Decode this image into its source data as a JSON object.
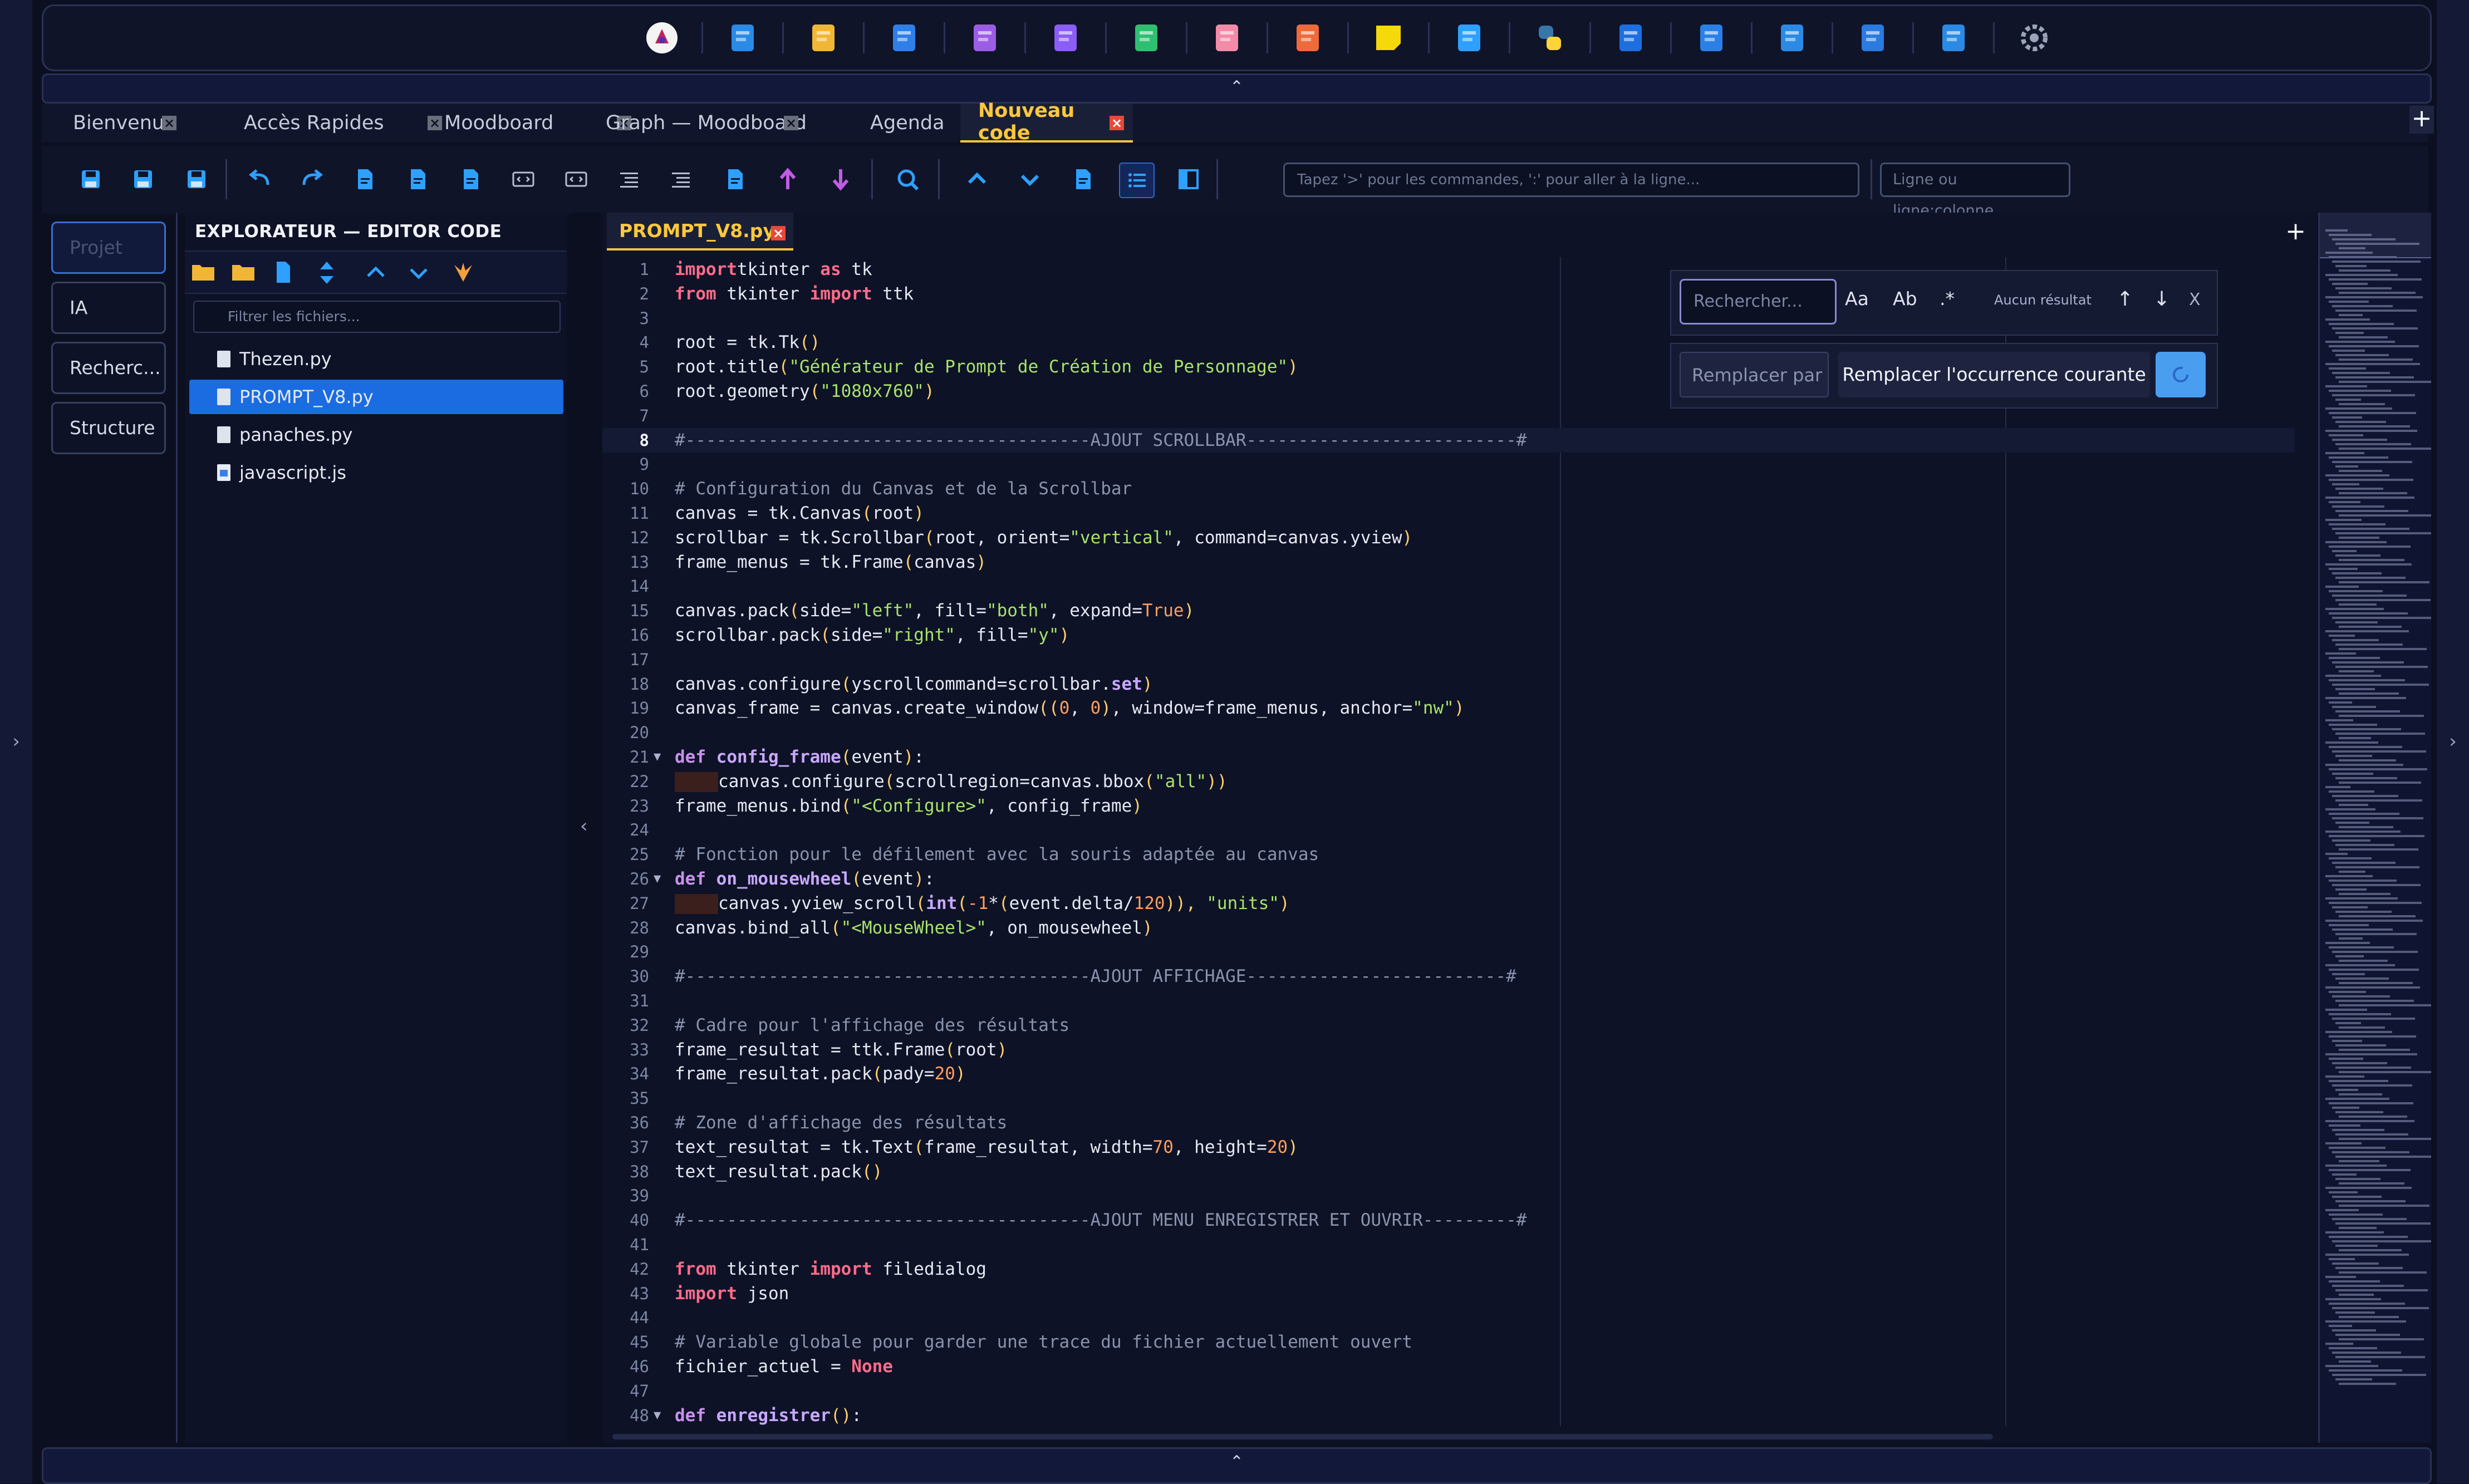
{
  "dock": {
    "items": [
      "app-logo-icon",
      "window-icon",
      "gallery-icon",
      "calendar-icon",
      "purple-app-icon",
      "doc-icon",
      "xls-icon",
      "pdf-icon",
      "epub-icon",
      "sticky-note-icon",
      "code-file-icon",
      "python-icon",
      "waveform-icon",
      "image-icon",
      "music-icon",
      "video-icon",
      "browser-icon",
      "settings-icon"
    ]
  },
  "tabs": [
    {
      "label": "Bienvenue",
      "active": false
    },
    {
      "label": "Accès Rapides",
      "active": false
    },
    {
      "label": "Moodboard",
      "active": false
    },
    {
      "label": "Graph — Moodboard",
      "active": false
    },
    {
      "label": "Agenda",
      "active": false
    },
    {
      "label": "Nouveau code",
      "active": true
    }
  ],
  "toolbar": {
    "command_placeholder": "Tapez '>' pour les commandes, ':' pour aller à la ligne...",
    "line_placeholder": "Ligne ou ligne:colonne"
  },
  "left_nav": {
    "items": [
      {
        "label": "Projet",
        "active": true
      },
      {
        "label": "IA",
        "active": false
      },
      {
        "label": "Recherc...",
        "active": false
      },
      {
        "label": "Structure",
        "active": false
      }
    ]
  },
  "explorer": {
    "title": "EXPLORATEUR — EDITOR CODE",
    "filter_placeholder": "Filtrer les fichiers...",
    "files": [
      {
        "name": "Thezen.py",
        "selected": false,
        "type": "py"
      },
      {
        "name": "PROMPT_V8.py",
        "selected": true,
        "type": "py"
      },
      {
        "name": "panaches.py",
        "selected": false,
        "type": "py"
      },
      {
        "name": "javascript.js",
        "selected": false,
        "type": "js"
      }
    ]
  },
  "editor": {
    "tab": "PROMPT_V8.py",
    "current_line": 8
  },
  "find": {
    "placeholder": "Rechercher...",
    "opt_case": "Aa",
    "opt_word": "Ab",
    "opt_regex": ".*",
    "status": "Aucun résultat",
    "close": "X",
    "replace_placeholder": "Remplacer par",
    "replace_button": "Remplacer l'occurrence courante"
  },
  "code": [
    {
      "n": "1",
      "t": [
        [
          "kw",
          "import"
        ],
        [
          "",
          "tkinter "
        ],
        [
          "kw",
          "as"
        ],
        [
          "",
          " tk"
        ]
      ]
    },
    {
      "n": "2",
      "t": [
        [
          "kw",
          "from"
        ],
        [
          "",
          "",
          " tkinter "
        ],
        [
          "kw",
          "import"
        ],
        [
          "",
          " ttk"
        ]
      ]
    },
    {
      "n": "3",
      "t": []
    },
    {
      "n": "4",
      "t": [
        [
          "",
          "root = tk.Tk"
        ],
        [
          "bi",
          "()"
        ]
      ]
    },
    {
      "n": "5",
      "t": [
        [
          "",
          "root.title"
        ],
        [
          "bi",
          "("
        ],
        [
          "st",
          "\"Générateur de Prompt de Création de Personnage\""
        ],
        [
          "bi",
          ")"
        ]
      ]
    },
    {
      "n": "6",
      "t": [
        [
          "",
          "root.geometry"
        ],
        [
          "bi",
          "("
        ],
        [
          "st",
          "\"1080x760\""
        ],
        [
          "bi",
          ")"
        ]
      ]
    },
    {
      "n": "7",
      "t": []
    },
    {
      "n": "8",
      "t": [
        [
          "cm",
          "#---------------------------------------AJOUT SCROLLBAR--------------------------#"
        ]
      ]
    },
    {
      "n": "9",
      "t": []
    },
    {
      "n": "10",
      "t": [
        [
          "cm",
          "# Configuration du Canvas et de la Scrollbar"
        ]
      ]
    },
    {
      "n": "11",
      "t": [
        [
          "",
          "canvas = tk.Canvas"
        ],
        [
          "bi",
          "("
        ],
        [
          "",
          "root"
        ],
        [
          "bi",
          ")"
        ]
      ]
    },
    {
      "n": "12",
      "t": [
        [
          "",
          "scrollbar = tk.Scrollbar"
        ],
        [
          "bi",
          "("
        ],
        [
          "",
          "root, orient="
        ],
        [
          "st",
          "\"vertical\""
        ],
        [
          "",
          ", command=canvas.yview"
        ],
        [
          "bi",
          ")"
        ]
      ]
    },
    {
      "n": "13",
      "t": [
        [
          "",
          "frame_menus = tk.Frame"
        ],
        [
          "bi",
          "("
        ],
        [
          "",
          "canvas"
        ],
        [
          "bi",
          ")"
        ]
      ]
    },
    {
      "n": "14",
      "t": []
    },
    {
      "n": "15",
      "t": [
        [
          "",
          "canvas.pack"
        ],
        [
          "bi",
          "("
        ],
        [
          "",
          "side="
        ],
        [
          "st",
          "\"left\""
        ],
        [
          "",
          ", fill="
        ],
        [
          "st",
          "\"both\""
        ],
        [
          "",
          ", expand="
        ],
        [
          "nm",
          "True"
        ],
        [
          "bi",
          ")"
        ]
      ]
    },
    {
      "n": "16",
      "t": [
        [
          "",
          "scrollbar.pack"
        ],
        [
          "bi",
          "("
        ],
        [
          "",
          "side="
        ],
        [
          "st",
          "\"right\""
        ],
        [
          "",
          ", fill="
        ],
        [
          "st",
          "\"y\""
        ],
        [
          "bi",
          ")"
        ]
      ]
    },
    {
      "n": "17",
      "t": []
    },
    {
      "n": "18",
      "t": [
        [
          "",
          "canvas.configure"
        ],
        [
          "bi",
          "("
        ],
        [
          "",
          "yscrollcommand=scrollbar."
        ],
        [
          "fn",
          "set"
        ],
        [
          "bi",
          ")"
        ]
      ]
    },
    {
      "n": "19",
      "t": [
        [
          "",
          "canvas_frame = canvas.create_window"
        ],
        [
          "bi",
          "(("
        ],
        [
          "nm",
          "0"
        ],
        [
          "",
          ", "
        ],
        [
          "nm",
          "0"
        ],
        [
          "bi",
          ")"
        ],
        [
          "",
          ", window=frame_menus, anchor="
        ],
        [
          "st",
          "\"nw\""
        ],
        [
          "bi",
          ")"
        ]
      ]
    },
    {
      "n": "20",
      "t": []
    },
    {
      "n": "21",
      "fold": true,
      "t": [
        [
          "kw2",
          "def"
        ],
        [
          "",
          " "
        ],
        [
          "fn",
          "config_frame"
        ],
        [
          "bi",
          "("
        ],
        [
          "",
          "event"
        ],
        [
          "bi",
          ")"
        ],
        [
          "",
          ":"
        ]
      ]
    },
    {
      "n": "22",
      "indent": true,
      "t": [
        [
          "",
          "canvas.configure"
        ],
        [
          "bi",
          "("
        ],
        [
          "",
          "scrollregion=canvas.bbox"
        ],
        [
          "bi",
          "("
        ],
        [
          "st",
          "\"all\""
        ],
        [
          "bi",
          "))"
        ]
      ]
    },
    {
      "n": "23",
      "t": [
        [
          "",
          "frame_menus.bind"
        ],
        [
          "bi",
          "("
        ],
        [
          "st",
          "\"<Configure>\""
        ],
        [
          "",
          ", config_frame"
        ],
        [
          "bi",
          ")"
        ]
      ]
    },
    {
      "n": "24",
      "t": []
    },
    {
      "n": "25",
      "t": [
        [
          "cm",
          "# Fonction pour le défilement avec la souris adaptée au canvas"
        ]
      ]
    },
    {
      "n": "26",
      "fold": true,
      "t": [
        [
          "kw2",
          "def"
        ],
        [
          "",
          " "
        ],
        [
          "fn",
          "on_mousewheel"
        ],
        [
          "bi",
          "("
        ],
        [
          "",
          "event"
        ],
        [
          "bi",
          ")"
        ],
        [
          "",
          ":"
        ]
      ]
    },
    {
      "n": "27",
      "indent": true,
      "t": [
        [
          "",
          "canvas.yview_scroll"
        ],
        [
          "bi",
          "("
        ],
        [
          "fn",
          "int"
        ],
        [
          "bi",
          "("
        ],
        [
          "nm",
          "-1"
        ],
        [
          "",
          "*"
        ],
        [
          "bi",
          "("
        ],
        [
          "",
          "event.delta/"
        ],
        [
          "nm",
          "120"
        ],
        [
          "bi",
          ")),"
        ],
        [
          "",
          " "
        ],
        [
          "st",
          "\"units\""
        ],
        [
          "bi",
          ")"
        ]
      ]
    },
    {
      "n": "28",
      "t": [
        [
          "",
          "canvas.bind_all"
        ],
        [
          "bi",
          "("
        ],
        [
          "st",
          "\"<MouseWheel>\""
        ],
        [
          "",
          ", on_mousewheel"
        ],
        [
          "bi",
          ")"
        ]
      ]
    },
    {
      "n": "29",
      "t": []
    },
    {
      "n": "30",
      "t": [
        [
          "cm",
          "#---------------------------------------AJOUT AFFICHAGE-------------------------#"
        ]
      ]
    },
    {
      "n": "31",
      "t": []
    },
    {
      "n": "32",
      "t": [
        [
          "cm",
          "# Cadre pour l'affichage des résultats"
        ]
      ]
    },
    {
      "n": "33",
      "t": [
        [
          "",
          "frame_resultat = ttk.Frame"
        ],
        [
          "bi",
          "("
        ],
        [
          "",
          "root"
        ],
        [
          "bi",
          ")"
        ]
      ]
    },
    {
      "n": "34",
      "t": [
        [
          "",
          "frame_resultat.pack"
        ],
        [
          "bi",
          "("
        ],
        [
          "",
          "pady="
        ],
        [
          "nm",
          "20"
        ],
        [
          "bi",
          ")"
        ]
      ]
    },
    {
      "n": "35",
      "t": []
    },
    {
      "n": "36",
      "t": [
        [
          "cm",
          "# Zone d'affichage des résultats"
        ]
      ]
    },
    {
      "n": "37",
      "t": [
        [
          "",
          "text_resultat = tk.Text"
        ],
        [
          "bi",
          "("
        ],
        [
          "",
          "frame_resultat, width="
        ],
        [
          "nm",
          "70"
        ],
        [
          "",
          ", height="
        ],
        [
          "nm",
          "20"
        ],
        [
          "bi",
          ")"
        ]
      ]
    },
    {
      "n": "38",
      "t": [
        [
          "",
          "text_resultat.pack"
        ],
        [
          "bi",
          "()"
        ]
      ]
    },
    {
      "n": "39",
      "t": []
    },
    {
      "n": "40",
      "t": [
        [
          "cm",
          "#---------------------------------------AJOUT MENU ENREGISTRER ET OUVRIR---------#"
        ]
      ]
    },
    {
      "n": "41",
      "t": []
    },
    {
      "n": "42",
      "t": [
        [
          "kw",
          "from"
        ],
        [
          "",
          " tkinter "
        ],
        [
          "kw",
          "import"
        ],
        [
          "",
          " filedialog"
        ]
      ]
    },
    {
      "n": "43",
      "t": [
        [
          "kw",
          "import"
        ],
        [
          "",
          " json"
        ]
      ]
    },
    {
      "n": "44",
      "t": []
    },
    {
      "n": "45",
      "t": [
        [
          "cm",
          "# Variable globale pour garder une trace du fichier actuellement ouvert"
        ]
      ]
    },
    {
      "n": "46",
      "t": [
        [
          "",
          "fichier_actuel = "
        ],
        [
          "kw",
          "None"
        ]
      ]
    },
    {
      "n": "47",
      "t": []
    },
    {
      "n": "48",
      "fold": true,
      "t": [
        [
          "kw2",
          "def"
        ],
        [
          "",
          " "
        ],
        [
          "fn",
          "enregistrer"
        ],
        [
          "bi",
          "()"
        ],
        [
          "",
          ":"
        ]
      ]
    }
  ]
}
